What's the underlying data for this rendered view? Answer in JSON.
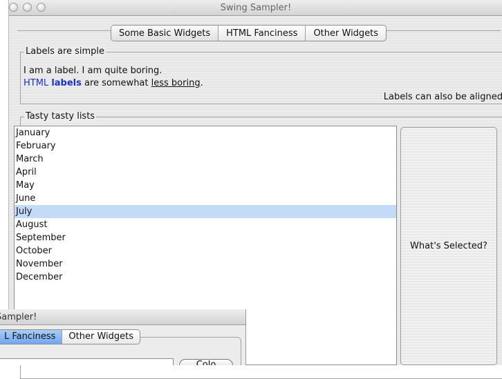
{
  "window": {
    "title": "Swing Sampler!",
    "tabs": [
      {
        "label": "Some Basic Widgets",
        "selected": true
      },
      {
        "label": "HTML Fanciness",
        "selected": false
      },
      {
        "label": "Other Widgets",
        "selected": false
      }
    ],
    "labels_group": {
      "title": "Labels are simple",
      "plain_label": "I am a label. I am quite boring.",
      "html_label": {
        "part1": "HTML",
        "part2": "labels",
        "part3": "are somewhat",
        "part4": "less boring",
        "part5": "."
      },
      "aligned_label": "Labels can also be aligned"
    },
    "lists_group": {
      "title": "Tasty tasty lists",
      "months": [
        "January",
        "February",
        "March",
        "April",
        "May",
        "June",
        "July",
        "August",
        "September",
        "October",
        "November",
        "December"
      ],
      "selected_item": "July",
      "button_label": "What's Selected?"
    }
  },
  "second_window": {
    "title_fragment": "Sampler!",
    "tabs": [
      {
        "label": "L Fanciness",
        "selected": true
      },
      {
        "label": "Other Widgets",
        "selected": false
      }
    ],
    "button_fragment": "Colo"
  },
  "colors": {
    "selection": "#c3dbf8",
    "html_blue": "#1a33cc",
    "tab_selected_blue": "#6fa8ee"
  }
}
